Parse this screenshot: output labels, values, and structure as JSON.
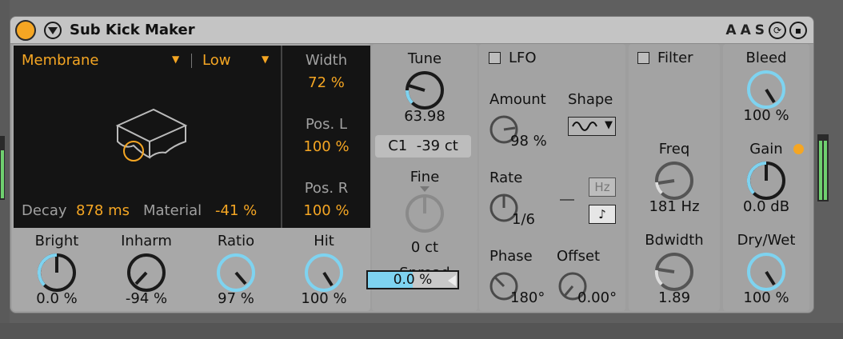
{
  "device": {
    "title": "Sub Kick Maker",
    "accent_color": "#f5a623",
    "knob_arc_color": "#7ed3f0",
    "titlebar_icons": [
      "A",
      "A",
      "S"
    ]
  },
  "resonator": {
    "type": "Membrane",
    "quality": "Low",
    "decay_label": "Decay",
    "decay_value": "878 ms",
    "material_label": "Material",
    "material_value": "-41 %",
    "width_label": "Width",
    "width_value": "72 %",
    "posl_label": "Pos. L",
    "posl_value": "100 %",
    "posr_label": "Pos. R",
    "posr_value": "100 %"
  },
  "bottom_knobs": [
    {
      "label": "Bright",
      "value": "0.0 %"
    },
    {
      "label": "Inharm",
      "value": "-94 %"
    },
    {
      "label": "Ratio",
      "value": "97 %"
    },
    {
      "label": "Hit",
      "value": "100 %"
    }
  ],
  "tune": {
    "label": "Tune",
    "value": "63.98",
    "note": "C1",
    "cents": "-39 ct",
    "fine_label": "Fine",
    "fine_value": "0 ct",
    "spread_label": "Spread",
    "spread_value": "0.0 %",
    "spread_fraction": 0.5
  },
  "lfo": {
    "label": "LFO",
    "amount_label": "Amount",
    "amount_value": "98 %",
    "shape_label": "Shape",
    "rate_label": "Rate",
    "rate_value": "1/6",
    "hz_label": "Hz",
    "note_label": "♪",
    "phase_label": "Phase",
    "phase_value": "180°",
    "offset_label": "Offset",
    "offset_value": "0.00°"
  },
  "filter": {
    "label": "Filter",
    "freq_label": "Freq",
    "freq_value": "181 Hz",
    "bw_label": "Bdwidth",
    "bw_value": "1.89"
  },
  "output": {
    "bleed_label": "Bleed",
    "bleed_value": "100 %",
    "gain_label": "Gain",
    "gain_value": "0.0 dB",
    "drywet_label": "Dry/Wet",
    "drywet_value": "100 %"
  }
}
